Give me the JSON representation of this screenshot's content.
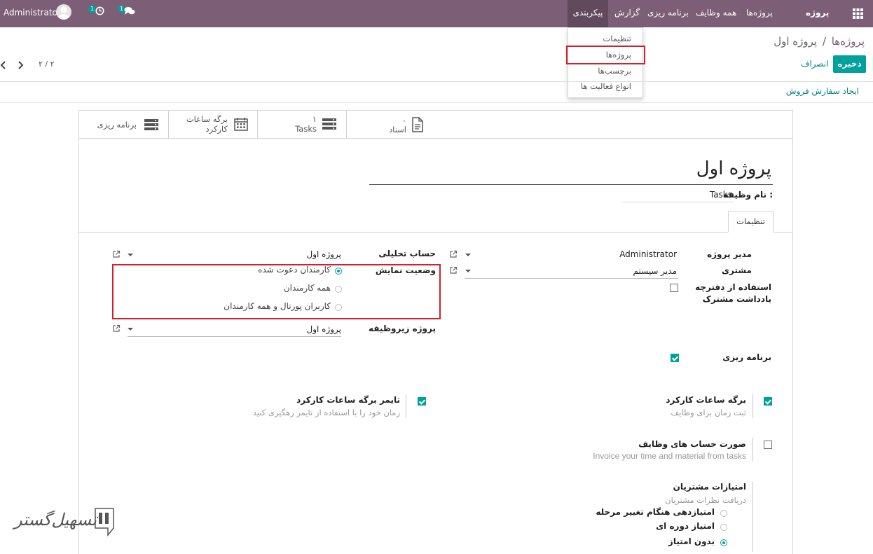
{
  "navbar": {
    "brand": "پروژه",
    "menu": [
      "پروژه‌ها",
      "همه وظایف",
      "برنامه ریزی",
      "گزارش",
      "پیکربندی"
    ],
    "user": "Administrator",
    "activity_badge": "1",
    "message_badge": "1"
  },
  "dropdown": {
    "items": [
      "تنظیمات",
      "پروژه‌ها",
      "برچسب‌ها",
      "انواع فعالیت ها"
    ]
  },
  "control": {
    "breadcrumb_parent": "پروژه‌ها",
    "breadcrumb_sep": "/",
    "breadcrumb_current": "پروژه اول",
    "save_label": "ذخیره",
    "discard_label": "انصراف",
    "pager": "۲ / ۲",
    "action_link": "ایجاد سفارش فروش"
  },
  "stats": [
    {
      "count": "۰",
      "label": "اسناد",
      "icon": "document-icon"
    },
    {
      "count": "۱",
      "label": "Tasks",
      "icon": "tasks-icon"
    },
    {
      "count": "",
      "label": "برگه ساعات",
      "label2": "کارکرد",
      "icon": "calendar-icon"
    },
    {
      "count": "",
      "label": "برنامه ریزی",
      "icon": "planning-icon"
    }
  ],
  "form": {
    "title": "پروژه اول",
    "task_name_label": "نام وظیفه :",
    "task_name_value": "Tasks",
    "tab_settings": "تنظیمات",
    "project_manager_label": "مدیر پروژه",
    "project_manager_value": "Administrator",
    "customer_label": "مشتری",
    "customer_value": "مدیر سیستم",
    "shared_notes_label": "استفاده از دفترچه",
    "shared_notes_label2": "یادداشت مشترک",
    "analytic_label": "حساب تحلیلی",
    "analytic_value": "پروژه اول",
    "visibility_label": "وضعیت نمایش",
    "visibility_options": [
      "کارمندان دعوت شده",
      "همه کارمندان",
      "کاربران پورتال و همه کارمندان"
    ],
    "subtask_label": "پروژه زیروظیفه",
    "subtask_value": "پروژه اول",
    "planning_label": "برنامه ریزی",
    "timesheet_title": "برگه ساعات کارکرد",
    "timesheet_desc": "ثبت زمان برای وظایف",
    "timer_title": "تایمر برگه ساعات کارکرد",
    "timer_desc": "زمان خود را با استفاده از تایمر رهگیری کنید",
    "invoice_title": "صورت حساب های وظایف",
    "invoice_desc": "Invoice your time and material from tasks",
    "rating_title": "امتیازات مشتریان",
    "rating_desc": "دریافت نظرات مشتریان",
    "rating_options": [
      "امتیازدهی هنگام تغییر مرحله",
      "امتیاز دوره ای",
      "بدون امتیاز"
    ]
  },
  "watermark": "تسهیل‌گستر"
}
